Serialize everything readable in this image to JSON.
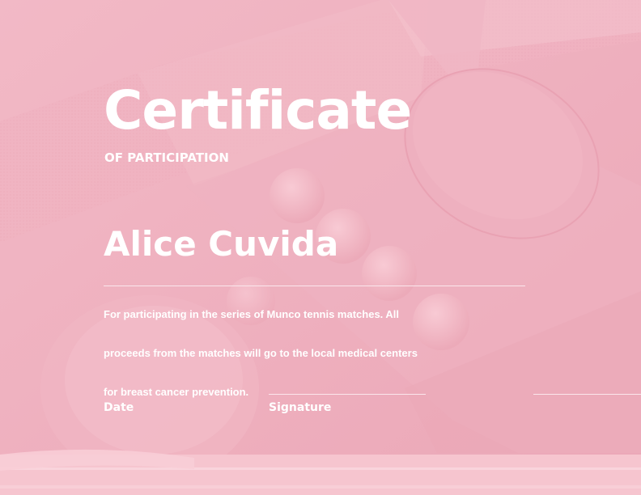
{
  "certificate": {
    "title": "Certificate",
    "subtitle": "OF PARTICIPATION",
    "recipient_name": "Alice Cuvida",
    "description_lines": [
      "For participating in the series of Munco tennis matches. All",
      "proceeds from the matches will go to the local medical centers",
      " for breast cancer prevention."
    ],
    "date_label": "Date",
    "signature_label": "Signature"
  },
  "background": {
    "image_description": "pink table tennis paddles and balls",
    "base_color": "#efb0bf",
    "text_color": "#ffffff"
  }
}
